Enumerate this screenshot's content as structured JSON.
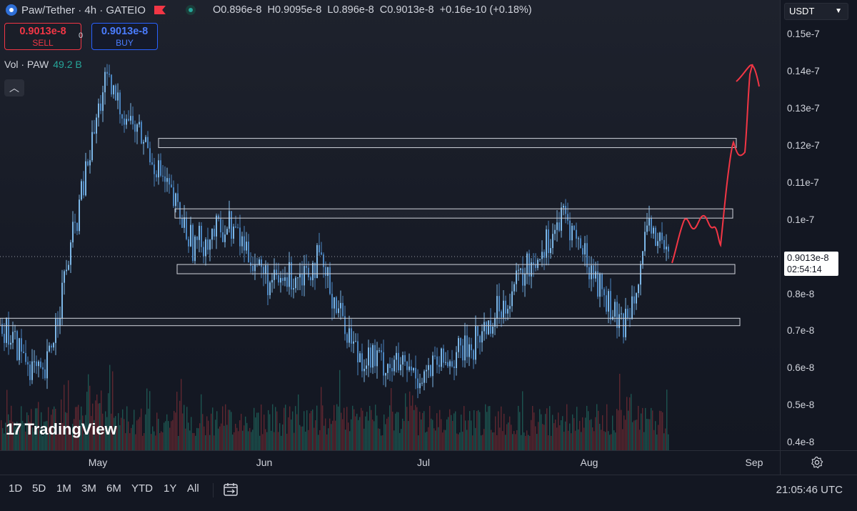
{
  "legend": {
    "title": "Paw/Tether · 4h · GATEIO",
    "open_label": "O",
    "open": "0.896e-8",
    "high_label": "H",
    "high": "0.9095e-8",
    "low_label": "L",
    "low": "0.896e-8",
    "close_label": "C",
    "close": "0.9013e-8",
    "change": "+0.16e-10 (+0.18%)"
  },
  "trade": {
    "sell_price": "0.9013e-8",
    "sell_label": "SELL",
    "buy_price": "0.9013e-8",
    "buy_label": "BUY",
    "spread": "0"
  },
  "volume_legend": {
    "label": "Vol · PAW",
    "value": "49.2 B"
  },
  "watermark": "TradingView",
  "currency": "USDT",
  "price_axis": [
    {
      "label": "0.15e-7",
      "value": 15.0
    },
    {
      "label": "0.14e-7",
      "value": 14.0
    },
    {
      "label": "0.13e-7",
      "value": 13.0
    },
    {
      "label": "0.12e-7",
      "value": 12.0
    },
    {
      "label": "0.11e-7",
      "value": 11.0
    },
    {
      "label": "0.1e-7",
      "value": 10.0
    },
    {
      "label": "0.8e-8",
      "value": 8.0
    },
    {
      "label": "0.7e-8",
      "value": 7.0
    },
    {
      "label": "0.6e-8",
      "value": 6.0
    },
    {
      "label": "0.5e-8",
      "value": 5.0
    },
    {
      "label": "0.4e-8",
      "value": 4.0
    }
  ],
  "last_price": {
    "value": "0.9013e-8",
    "countdown": "02:54:14"
  },
  "time_axis": [
    "May",
    "Jun",
    "Jul",
    "Aug",
    "Sep"
  ],
  "ranges": [
    "1D",
    "5D",
    "1M",
    "3M",
    "6M",
    "YTD",
    "1Y",
    "All"
  ],
  "clock": "21:05:46 UTC",
  "colors": {
    "up": "#26a69a",
    "down": "#f23645",
    "candle": "#5b9bd5",
    "drawing": "#f23645",
    "zone": "#d1d4dc"
  },
  "icons": {
    "settings": "gear-icon",
    "date_range": "calendar-range-icon",
    "collapse": "chevron-up-icon"
  },
  "chart_data": {
    "type": "candlestick",
    "title": "Paw/Tether · 4h · GATEIO",
    "y_unit": "e-8 USDT",
    "ylim": [
      3.8,
      15.6
    ],
    "xlabels": [
      "May",
      "Jun",
      "Jul",
      "Aug",
      "Sep"
    ],
    "close_path_approx": [
      {
        "t": "mid-Apr",
        "price": 7.2
      },
      {
        "t": "late-Apr",
        "price": 5.6
      },
      {
        "t": "early-May",
        "price": 13.7
      },
      {
        "t": "May",
        "price": 12.0
      },
      {
        "t": "mid-May",
        "price": 9.3
      },
      {
        "t": "late-May",
        "price": 9.9
      },
      {
        "t": "early-Jun",
        "price": 8.2
      },
      {
        "t": "mid-Jun",
        "price": 8.9
      },
      {
        "t": "late-Jun",
        "price": 6.4
      },
      {
        "t": "Jul",
        "price": 5.8
      },
      {
        "t": "mid-Jul",
        "price": 6.6
      },
      {
        "t": "late-Jul",
        "price": 10.1
      },
      {
        "t": "early-Aug",
        "price": 7.0
      },
      {
        "t": "mid-Aug",
        "price": 9.8
      },
      {
        "t": "last",
        "price": 9.013
      }
    ],
    "zones": [
      {
        "low": 11.95,
        "high": 12.2
      },
      {
        "low": 10.05,
        "high": 10.3
      },
      {
        "low": 8.55,
        "high": 8.8
      },
      {
        "low": 7.15,
        "high": 7.35
      }
    ],
    "last_price": 9.013
  }
}
